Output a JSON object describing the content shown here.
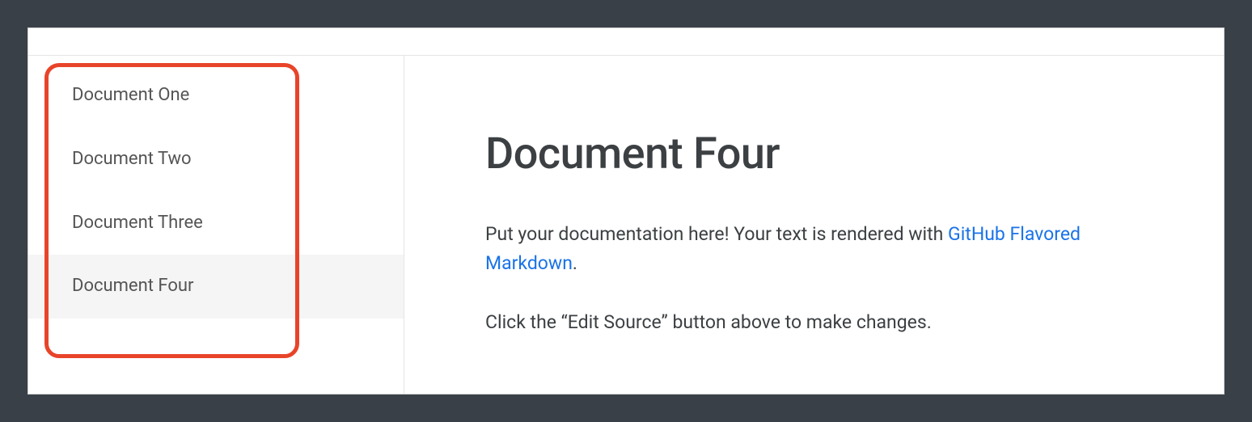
{
  "sidebar": {
    "items": [
      {
        "label": "Document One",
        "selected": false
      },
      {
        "label": "Document Two",
        "selected": false
      },
      {
        "label": "Document Three",
        "selected": false
      },
      {
        "label": "Document Four",
        "selected": true
      }
    ]
  },
  "main": {
    "title": "Document Four",
    "paragraph1_prefix": "Put your documentation here! Your text is rendered with ",
    "paragraph1_link": "GitHub Flavored Markdown",
    "paragraph1_suffix": ".",
    "paragraph2": "Click the “Edit Source” button above to make changes."
  },
  "colors": {
    "highlight_border": "#e8442a",
    "link": "#1a73e8",
    "text": "#3c4043",
    "selected_bg": "#f5f5f5"
  }
}
